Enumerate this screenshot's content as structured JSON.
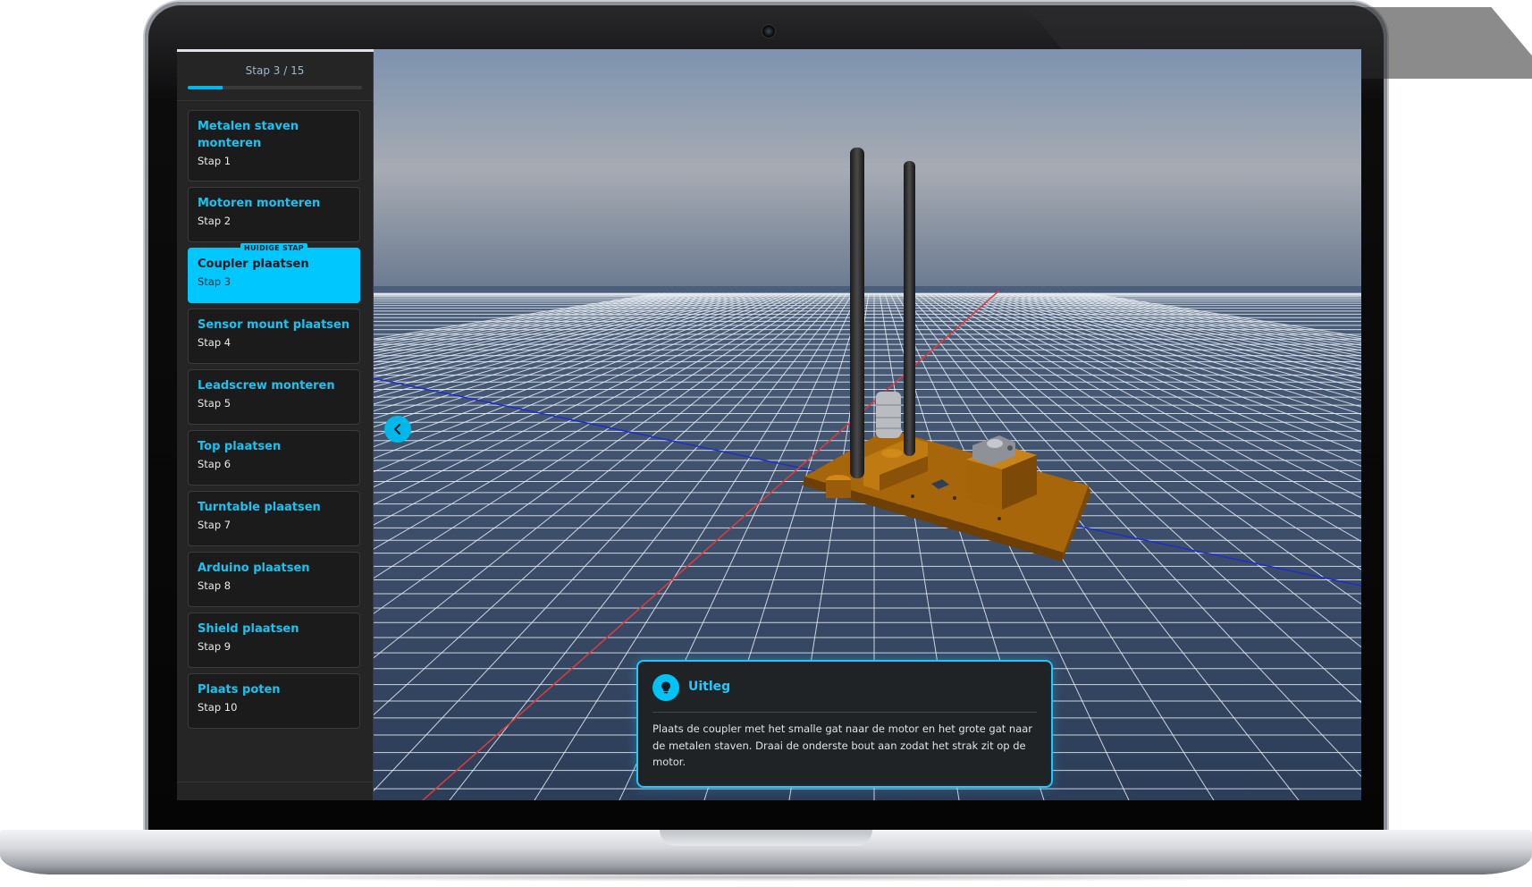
{
  "progress": {
    "label": "Stap 3 / 15",
    "current": 3,
    "total": 15
  },
  "steps": [
    {
      "title": "Metalen staven monteren",
      "sub": "Stap 1"
    },
    {
      "title": "Motoren monteren",
      "sub": "Stap 2"
    },
    {
      "title": "Coupler plaatsen",
      "sub": "Stap 3",
      "badge": "HUIDIGE STAP",
      "active": true
    },
    {
      "title": "Sensor mount plaatsen",
      "sub": "Stap 4"
    },
    {
      "title": "Leadscrew monteren",
      "sub": "Stap 5"
    },
    {
      "title": "Top plaatsen",
      "sub": "Stap 6"
    },
    {
      "title": "Turntable plaatsen",
      "sub": "Stap 7"
    },
    {
      "title": "Arduino plaatsen",
      "sub": "Stap 8"
    },
    {
      "title": "Shield plaatsen",
      "sub": "Stap 9"
    },
    {
      "title": "Plaats poten",
      "sub": "Stap 10"
    }
  ],
  "explanation": {
    "title": "Uitleg",
    "text": "Plaats de coupler met het smalle gat naar de motor en het grote gat naar de metalen staven. Draai de onderste bout aan zodat het strak zit op de motor."
  },
  "icons": {
    "collapse": "chevron-left-icon",
    "explanation": "lightbulb-icon"
  },
  "colors": {
    "accent": "#00c8ff",
    "sidebar_bg": "#252525",
    "card_bg": "#1b1b1b",
    "model_wood": "#b8720c"
  }
}
